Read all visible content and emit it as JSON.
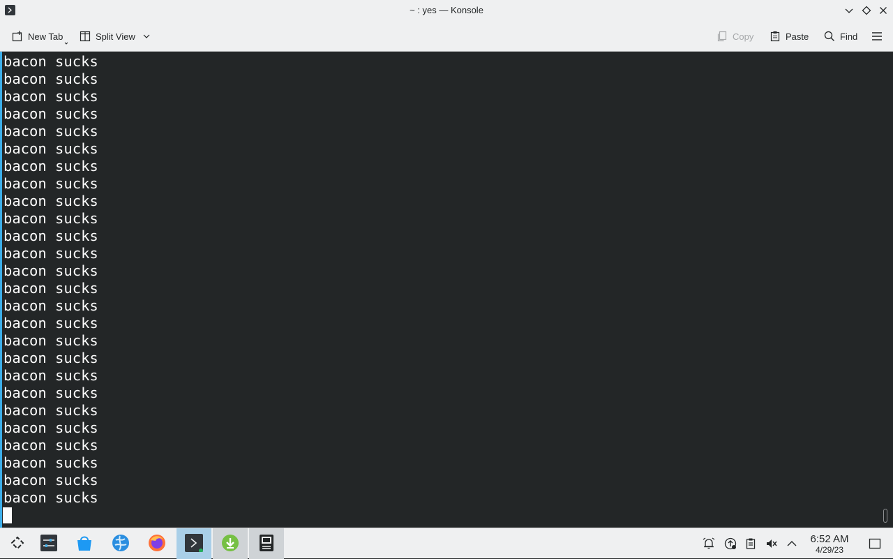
{
  "window": {
    "title": "~ : yes — Konsole"
  },
  "toolbar": {
    "new_tab_label": "New Tab",
    "split_view_label": "Split View",
    "copy_label": "Copy",
    "paste_label": "Paste",
    "find_label": "Find"
  },
  "terminal": {
    "lines": [
      "bacon sucks",
      "bacon sucks",
      "bacon sucks",
      "bacon sucks",
      "bacon sucks",
      "bacon sucks",
      "bacon sucks",
      "bacon sucks",
      "bacon sucks",
      "bacon sucks",
      "bacon sucks",
      "bacon sucks",
      "bacon sucks",
      "bacon sucks",
      "bacon sucks",
      "bacon sucks",
      "bacon sucks",
      "bacon sucks",
      "bacon sucks",
      "bacon sucks",
      "bacon sucks",
      "bacon sucks",
      "bacon sucks",
      "bacon sucks",
      "bacon sucks",
      "bacon sucks"
    ]
  },
  "taskbar": {
    "clock_time": "6:52 AM",
    "clock_date": "4/29/23",
    "apps": [
      {
        "name": "application-launcher-icon"
      },
      {
        "name": "system-settings-icon"
      },
      {
        "name": "discover-store-icon"
      },
      {
        "name": "web-browser-icon"
      },
      {
        "name": "firefox-icon"
      },
      {
        "name": "konsole-icon"
      },
      {
        "name": "download-manager-icon"
      },
      {
        "name": "document-viewer-icon"
      }
    ],
    "tray": [
      "notifications-icon",
      "updates-icon",
      "clipboard-icon",
      "volume-muted-icon",
      "show-hidden-icons-chevron"
    ]
  },
  "colors": {
    "terminal_bg": "#232627",
    "terminal_fg": "#fcfcfc",
    "accent": "#3daee9",
    "chrome_bg": "#eff0f1"
  }
}
